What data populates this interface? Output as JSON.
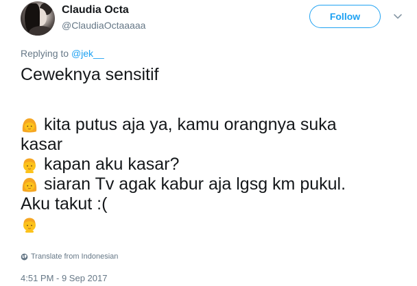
{
  "header": {
    "display_name": "Claudia Octa",
    "handle": "@ClaudiaOctaaaaa",
    "follow_label": "Follow"
  },
  "reply": {
    "prefix": "Replying to",
    "mention": "@jek__"
  },
  "tweet": {
    "line1": "Ceweknya sensitif",
    "line2": "kita putus aja ya, kamu orangnya suka",
    "line3": "kasar",
    "line4": "kapan aku kasar?",
    "line5": "siaran Tv agak kabur aja lgsg km pukul.",
    "line6": "Aku takut :("
  },
  "emoji": {
    "girl": "girl-emoji",
    "boy": "boy-emoji",
    "color": "#fcc21b"
  },
  "footer": {
    "translate_label": "Translate from Indonesian",
    "timestamp": "4:51 PM - 9 Sep 2017"
  },
  "colors": {
    "accent": "#1da1f2",
    "muted": "#657786",
    "text": "#14171a"
  }
}
